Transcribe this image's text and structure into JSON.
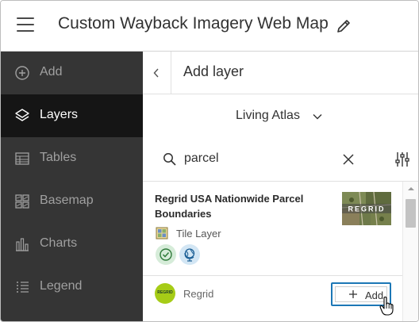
{
  "header": {
    "title": "Custom Wayback Imagery Web Map"
  },
  "sidebar": {
    "items": [
      {
        "label": "Add",
        "icon": "add-circle-icon",
        "active": false
      },
      {
        "label": "Layers",
        "icon": "layers-icon",
        "active": true
      },
      {
        "label": "Tables",
        "icon": "table-icon",
        "active": false
      },
      {
        "label": "Basemap",
        "icon": "basemap-icon",
        "active": false
      },
      {
        "label": "Charts",
        "icon": "charts-icon",
        "active": false
      },
      {
        "label": "Legend",
        "icon": "legend-icon",
        "active": false
      }
    ]
  },
  "panel": {
    "title": "Add layer",
    "source": "Living Atlas",
    "search": {
      "value": "parcel"
    }
  },
  "result": {
    "title": "Regrid USA Nationwide Parcel Boundaries",
    "thumbnail_text": "REGRID",
    "layer_type": "Tile Layer",
    "badges": [
      "authoritative-icon",
      "living-atlas-icon"
    ],
    "owner": "Regrid",
    "owner_logo_text": "REGRID",
    "add_label": "Add"
  },
  "colors": {
    "sidebar_bg": "#353535",
    "sidebar_active": "#151515",
    "accent_blue": "#1c77b6",
    "owner_logo": "#a6cc17"
  }
}
